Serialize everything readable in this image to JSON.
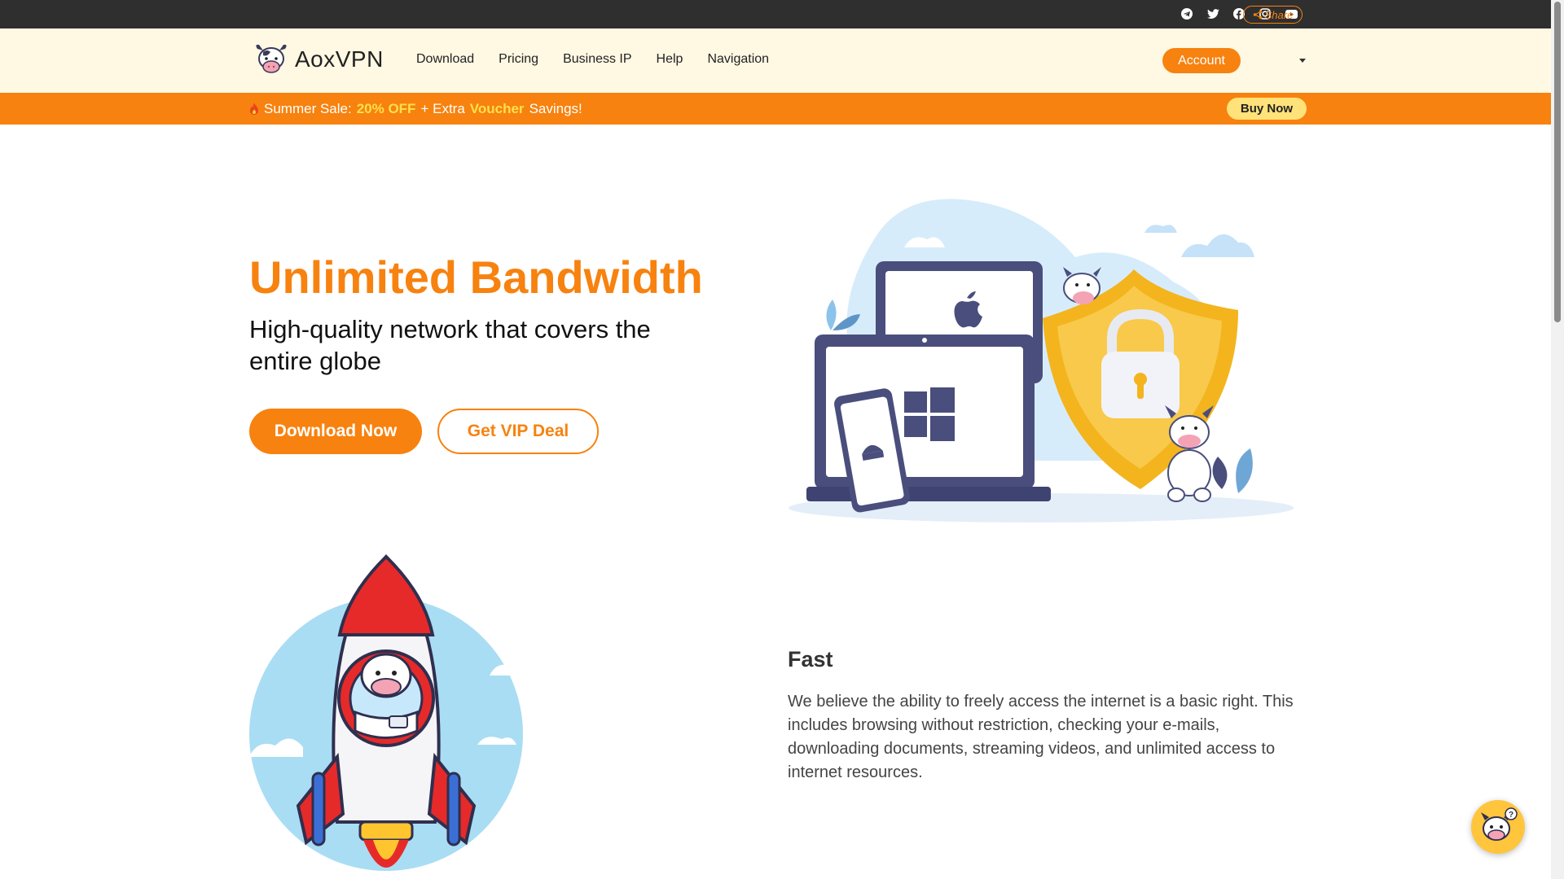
{
  "topbar": {
    "social_icons": [
      "telegram-icon",
      "twitter-icon",
      "facebook-icon",
      "instagram-icon",
      "youtube-icon"
    ],
    "share_label": "Share"
  },
  "nav": {
    "brand": "AoxVPN",
    "links": [
      "Download",
      "Pricing",
      "Business IP",
      "Help",
      "Navigation"
    ],
    "account_label": "Account"
  },
  "promo": {
    "icon": "fire-icon",
    "prefix": "Summer Sale:",
    "discount": "20% OFF",
    "mid": "+ Extra",
    "voucher": "Voucher",
    "suffix": "Savings!",
    "buy_label": "Buy Now"
  },
  "hero": {
    "title": "Unlimited Bandwidth",
    "subtitle": "High-quality network that covers the entire globe",
    "primary_cta": "Download Now",
    "secondary_cta": "Get VIP Deal"
  },
  "feature": {
    "title": "Fast",
    "description": "We believe the ability to freely access the internet is a basic right. This includes browsing without restriction, checking your e-mails, downloading documents, streaming videos, and unlimited access to internet resources."
  },
  "colors": {
    "brand_orange": "#f7820f",
    "highlight_yellow": "#ffe04a",
    "nav_bg": "#fff8e3",
    "topbar_bg": "#2f2f2f"
  }
}
